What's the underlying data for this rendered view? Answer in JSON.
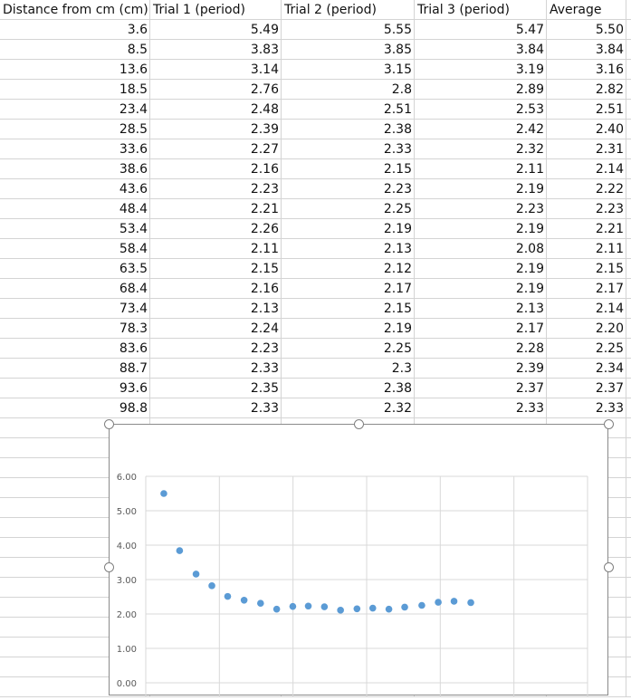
{
  "sheet": {
    "headers": [
      "Distance from cm (cm)",
      "Trial 1 (period)",
      "Trial 2 (period)",
      "Trial 3 (period)",
      "Average"
    ],
    "rows": [
      [
        "3.6",
        "5.49",
        "5.55",
        "5.47",
        "5.50"
      ],
      [
        "8.5",
        "3.83",
        "3.85",
        "3.84",
        "3.84"
      ],
      [
        "13.6",
        "3.14",
        "3.15",
        "3.19",
        "3.16"
      ],
      [
        "18.5",
        "2.76",
        "2.8",
        "2.89",
        "2.82"
      ],
      [
        "23.4",
        "2.48",
        "2.51",
        "2.53",
        "2.51"
      ],
      [
        "28.5",
        "2.39",
        "2.38",
        "2.42",
        "2.40"
      ],
      [
        "33.6",
        "2.27",
        "2.33",
        "2.32",
        "2.31"
      ],
      [
        "38.6",
        "2.16",
        "2.15",
        "2.11",
        "2.14"
      ],
      [
        "43.6",
        "2.23",
        "2.23",
        "2.19",
        "2.22"
      ],
      [
        "48.4",
        "2.21",
        "2.25",
        "2.23",
        "2.23"
      ],
      [
        "53.4",
        "2.26",
        "2.19",
        "2.19",
        "2.21"
      ],
      [
        "58.4",
        "2.11",
        "2.13",
        "2.08",
        "2.11"
      ],
      [
        "63.5",
        "2.15",
        "2.12",
        "2.19",
        "2.15"
      ],
      [
        "68.4",
        "2.16",
        "2.17",
        "2.19",
        "2.17"
      ],
      [
        "73.4",
        "2.13",
        "2.15",
        "2.13",
        "2.14"
      ],
      [
        "78.3",
        "2.24",
        "2.19",
        "2.17",
        "2.20"
      ],
      [
        "83.6",
        "2.23",
        "2.25",
        "2.28",
        "2.25"
      ],
      [
        "88.7",
        "2.33",
        "2.3",
        "2.39",
        "2.34"
      ],
      [
        "93.6",
        "2.35",
        "2.38",
        "2.37",
        "2.37"
      ],
      [
        "98.8",
        "2.33",
        "2.32",
        "2.33",
        "2.33"
      ]
    ]
  },
  "chart_data": {
    "type": "scatter",
    "title": "",
    "xlabel": "",
    "ylabel": "",
    "x": [
      3.6,
      8.5,
      13.6,
      18.5,
      23.4,
      28.5,
      33.6,
      38.6,
      43.6,
      48.4,
      53.4,
      58.4,
      63.5,
      68.4,
      73.4,
      78.3,
      83.6,
      88.7,
      93.6,
      98.8
    ],
    "y": [
      5.5,
      3.84,
      3.16,
      2.82,
      2.51,
      2.4,
      2.31,
      2.14,
      2.22,
      2.23,
      2.21,
      2.11,
      2.15,
      2.17,
      2.14,
      2.2,
      2.25,
      2.34,
      2.37,
      2.33
    ],
    "ylim": [
      0,
      6
    ],
    "xlim": [
      -2,
      135
    ],
    "yticks": [
      "0.00",
      "1.00",
      "2.00",
      "3.00",
      "4.00",
      "5.00",
      "6.00"
    ],
    "grid": true,
    "marker_color": "#5b9bd5"
  }
}
